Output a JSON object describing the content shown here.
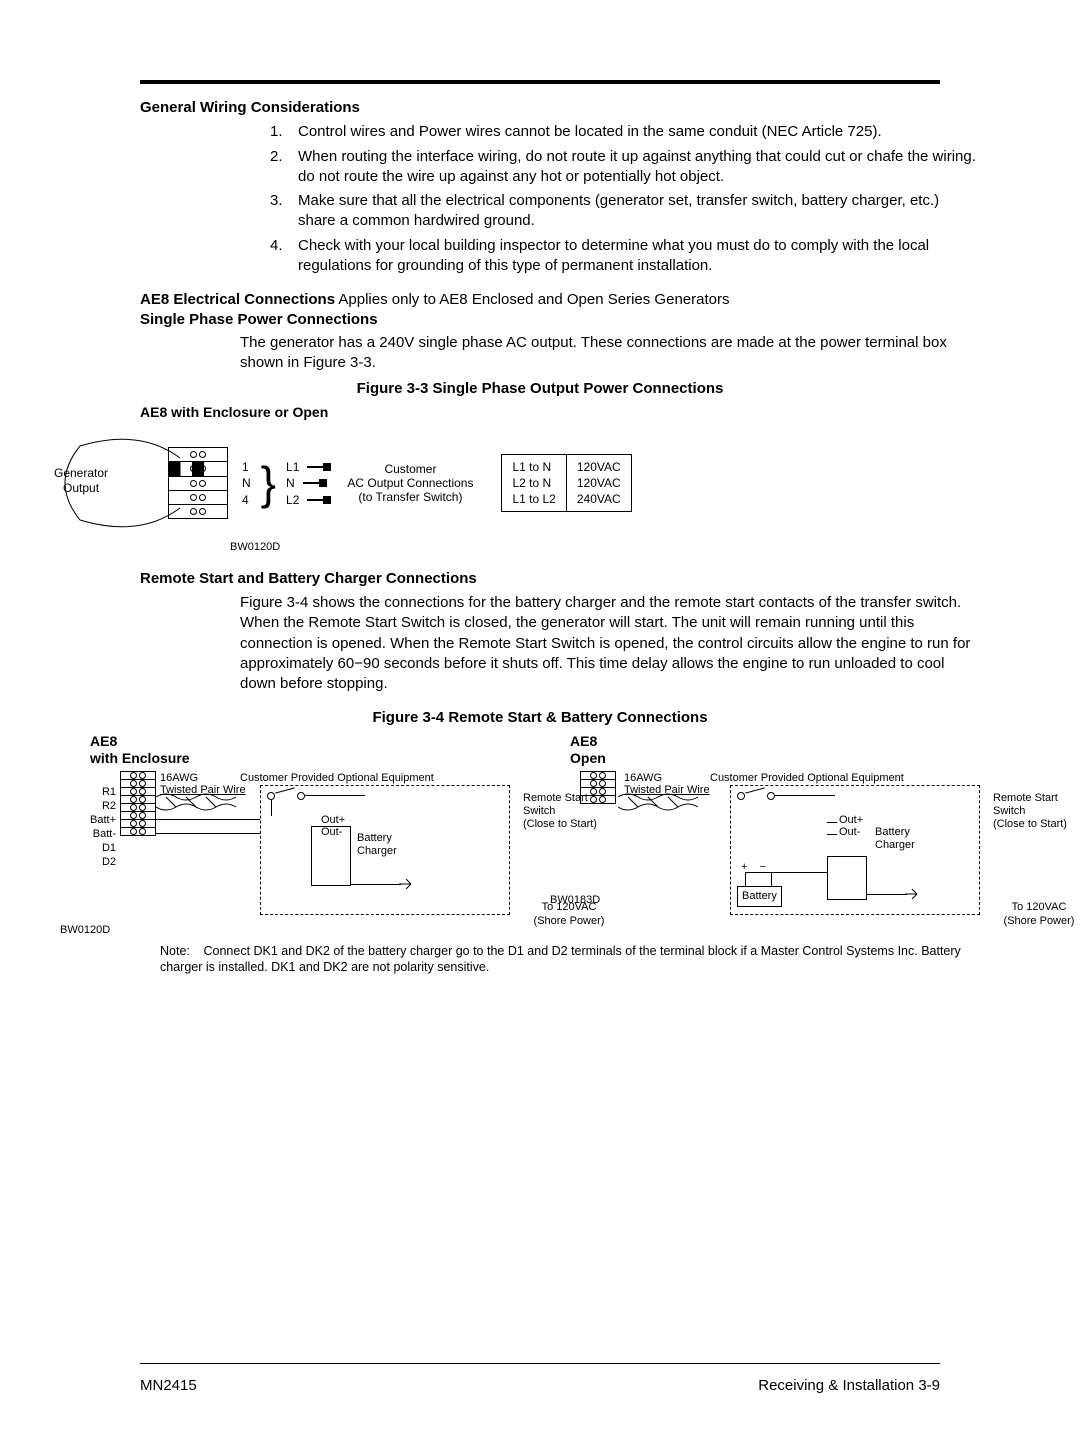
{
  "section1": {
    "title": "General Wiring Considerations",
    "items": [
      "Control wires and Power wires cannot be located in the same conduit (NEC Article 725).",
      "When routing the interface wiring, do not route it up against anything that could cut or chafe the wiring. do not route the wire up against any hot or potentially hot object.",
      "Make sure that all the electrical components (generator set, transfer switch, battery charger, etc.) share a common hardwired ground.",
      "Check with your local building inspector to determine what you must do to comply with the local regulations for grounding of this type of permanent installation."
    ]
  },
  "section2": {
    "title": "AE8 Electrical Connections",
    "note": "   Applies only to AE8 Enclosed and Open Series Generators",
    "sub1_title": "Single Phase Power Connections",
    "sub1_para": "The generator has a 240V single phase AC output.  These connections are made at the power terminal box shown in Figure 3-3."
  },
  "fig33": {
    "caption": "Figure 3-3  Single Phase Output Power Connections",
    "subcaption": "AE8 with Enclosure or Open",
    "gen_label_1": "Generator",
    "gen_label_2": "Output",
    "pins": [
      "1",
      "N",
      "4"
    ],
    "lns": [
      "L1",
      "N",
      "L2"
    ],
    "cust1": "Customer",
    "cust2": "AC Output Connections",
    "cust3": "(to Transfer Switch)",
    "bw": "BW0120D",
    "volt_rows": [
      "L1 to N",
      "L2 to N",
      "L1 to L2"
    ],
    "volt_vals": [
      "120VAC",
      "120VAC",
      "240VAC"
    ]
  },
  "section3": {
    "title": "Remote Start and Battery Charger Connections",
    "para": "Figure 3-4 shows the connections for the battery charger and the remote start contacts of the transfer switch. When the Remote Start Switch is closed, the generator will start. The unit will remain running until this connection is opened. When the Remote Start Switch is opened, the control circuits allow the engine to run for approximately 60−90 seconds before it shuts off. This time delay allows the engine to run unloaded to cool down before stopping."
  },
  "fig34": {
    "caption": "Figure 3-4  Remote Start & Battery Connections",
    "left_title_1": "AE8",
    "left_title_2": "with Enclosure",
    "right_title_1": "AE8",
    "right_title_2": "Open",
    "row_labels": [
      "R1",
      "R2",
      "Batt+",
      "Batt-",
      "D1",
      "D2"
    ],
    "awg": "16AWG",
    "twisted": "Twisted Pair Wire",
    "opt_eq": "Customer Provided Optional Equipment",
    "rss1": "Remote Start Switch",
    "rss2": "(Close to Start)",
    "out_plus": "Out+",
    "out_minus": "Out-",
    "bc1": "Battery",
    "bc2": "Charger",
    "shore1": "To 120VAC",
    "shore2": "(Shore Power)",
    "battery": "Battery",
    "bw_left": "BW0120D",
    "bw_right": "BW0183D"
  },
  "note": {
    "label": "Note:",
    "text": "Connect DK1 and DK2 of the battery charger go to the D1 and D2 terminals of the terminal block if a Master Control Systems Inc. Battery charger is installed.  DK1 and DK2 are not polarity sensitive."
  },
  "footer": {
    "left": "MN2415",
    "right": "Receiving & Installation  3-9"
  }
}
